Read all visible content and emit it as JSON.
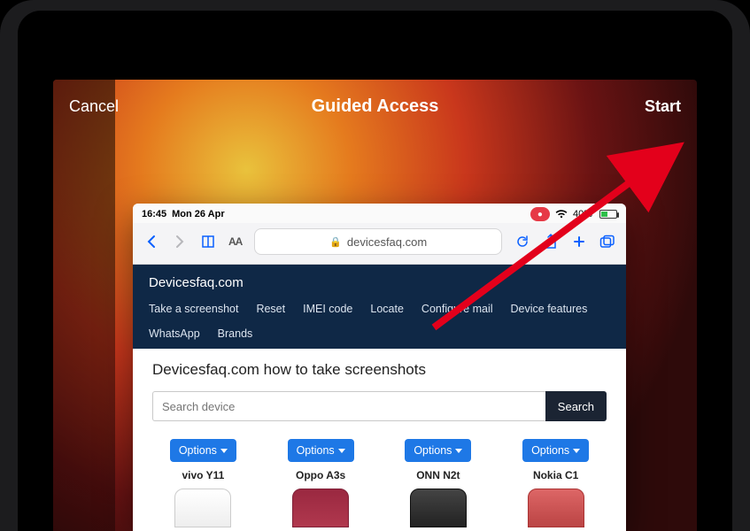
{
  "guided_access": {
    "cancel": "Cancel",
    "title": "Guided Access",
    "start": "Start"
  },
  "status": {
    "time": "16:45",
    "date": "Mon 26 Apr",
    "battery_text": "40%",
    "battery_level": 40,
    "recording": true
  },
  "safari": {
    "text_size_label": "AA",
    "domain": "devicesfaq.com"
  },
  "site": {
    "brand": "Devicesfaq.com",
    "nav": [
      "Take a screenshot",
      "Reset",
      "IMEI code",
      "Locate",
      "Configure mail",
      "Device features",
      "WhatsApp",
      "Brands"
    ]
  },
  "page": {
    "heading": "Devicesfaq.com how to take screenshots",
    "search_placeholder": "Search device",
    "search_button": "Search",
    "options_label": "Options",
    "devices": [
      "vivo Y11",
      "Oppo A3s",
      "ONN N2t",
      "Nokia C1"
    ]
  },
  "colors": {
    "accent_blue": "#1e78e6",
    "safari_blue": "#0a60ff",
    "sitenav_bg": "#0f2846",
    "arrow_red": "#e3001b"
  }
}
